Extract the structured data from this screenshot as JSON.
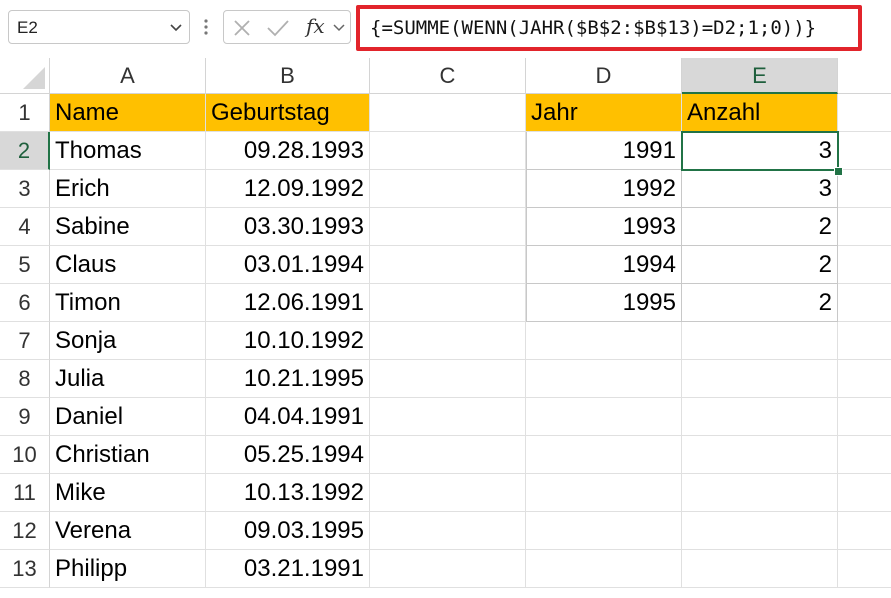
{
  "namebox": {
    "value": "E2"
  },
  "formula": {
    "text": "{=SUMME(WENN(JAHR($B$2:$B$13)=D2;1;0))}"
  },
  "fx_label": "fx",
  "columns": [
    "A",
    "B",
    "C",
    "D",
    "E"
  ],
  "rows": [
    "1",
    "2",
    "3",
    "4",
    "5",
    "6",
    "7",
    "8",
    "9",
    "10",
    "11",
    "12",
    "13"
  ],
  "table1": {
    "header": {
      "name": "Name",
      "birthday": "Geburtstag"
    },
    "rows": [
      {
        "name": "Thomas",
        "birthday": "09.28.1993"
      },
      {
        "name": "Erich",
        "birthday": "12.09.1992"
      },
      {
        "name": "Sabine",
        "birthday": "03.30.1993"
      },
      {
        "name": "Claus",
        "birthday": "03.01.1994"
      },
      {
        "name": "Timon",
        "birthday": "12.06.1991"
      },
      {
        "name": "Sonja",
        "birthday": "10.10.1992"
      },
      {
        "name": "Julia",
        "birthday": "10.21.1995"
      },
      {
        "name": "Daniel",
        "birthday": "04.04.1991"
      },
      {
        "name": "Christian",
        "birthday": "05.25.1994"
      },
      {
        "name": "Mike",
        "birthday": "10.13.1992"
      },
      {
        "name": "Verena",
        "birthday": "09.03.1995"
      },
      {
        "name": "Philipp",
        "birthday": "03.21.1991"
      }
    ]
  },
  "table2": {
    "header": {
      "year": "Jahr",
      "count": "Anzahl"
    },
    "rows": [
      {
        "year": "1991",
        "count": "3"
      },
      {
        "year": "1992",
        "count": "3"
      },
      {
        "year": "1993",
        "count": "2"
      },
      {
        "year": "1994",
        "count": "2"
      },
      {
        "year": "1995",
        "count": "2"
      }
    ]
  },
  "colors": {
    "header_fill": "#ffc000",
    "accent": "#217346",
    "formula_highlight": "#e2242b"
  }
}
